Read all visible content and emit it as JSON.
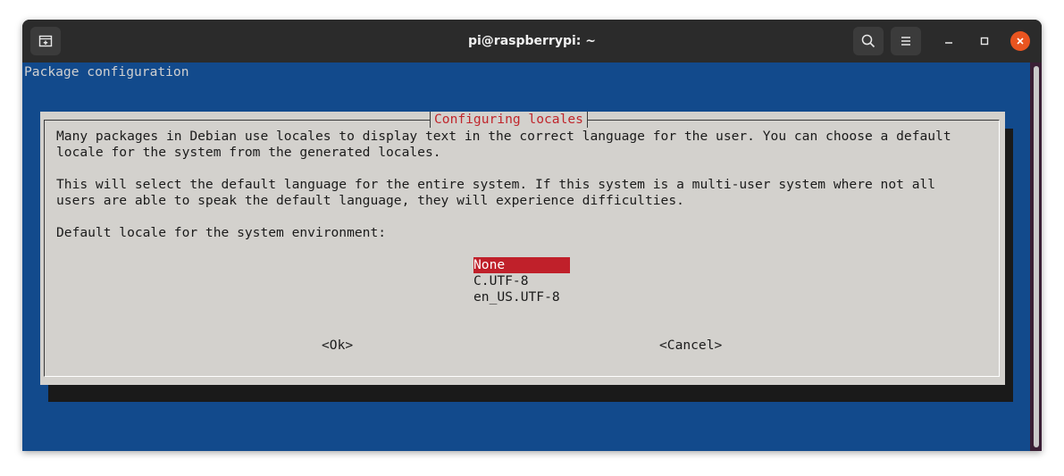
{
  "window": {
    "title": "pi@raspberrypi: ~",
    "accent_close": "#e95420"
  },
  "terminal": {
    "header": "Package configuration",
    "background": "#124a8c"
  },
  "dialog": {
    "title": "Configuring locales",
    "paragraph1_line1": "Many packages in Debian use locales to display text in the correct language for the user. You can choose a default",
    "paragraph1_line2": "locale for the system from the generated locales.",
    "paragraph2_line1": "This will select the default language for the entire system. If this system is a multi-user system where not all",
    "paragraph2_line2": "users are able to speak the default language, they will experience difficulties.",
    "prompt": "Default locale for the system environment:",
    "options": [
      "None",
      "C.UTF-8",
      "en_US.UTF-8"
    ],
    "selected_option": "None",
    "ok_label": "<Ok>",
    "cancel_label": "<Cancel>"
  },
  "icons": {
    "new_tab": "new-tab-icon",
    "search": "search-icon",
    "menu": "hamburger-menu-icon",
    "minimize": "minimize-icon",
    "maximize": "maximize-icon",
    "close": "close-icon"
  }
}
